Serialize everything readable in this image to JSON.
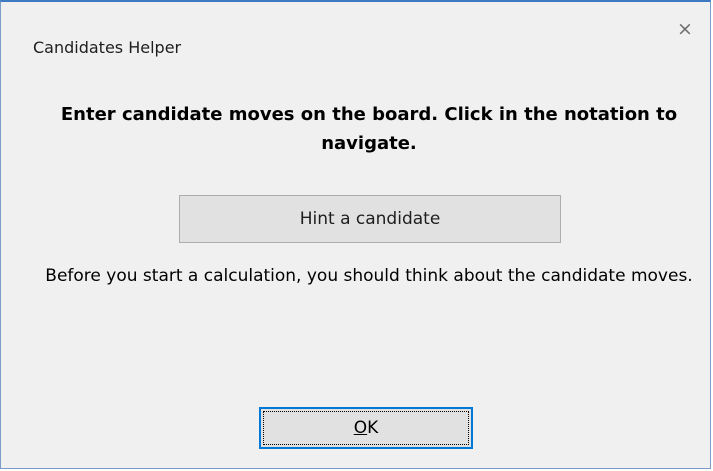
{
  "window": {
    "title": "Candidates Helper",
    "close_glyph": "×"
  },
  "main": {
    "heading": "Enter candidate moves on the board. Click in the notation to navigate.",
    "hint_button_label": "Hint a candidate",
    "info_text": "Before you start a calculation, you should think about the candidate moves."
  },
  "footer": {
    "ok_mnemonic": "O",
    "ok_rest": "K"
  },
  "colors": {
    "dialog_background": "#f0f0f0",
    "button_background": "#e1e1e1",
    "focus_border": "#0078d7",
    "window_border": "#3d7ac2"
  }
}
